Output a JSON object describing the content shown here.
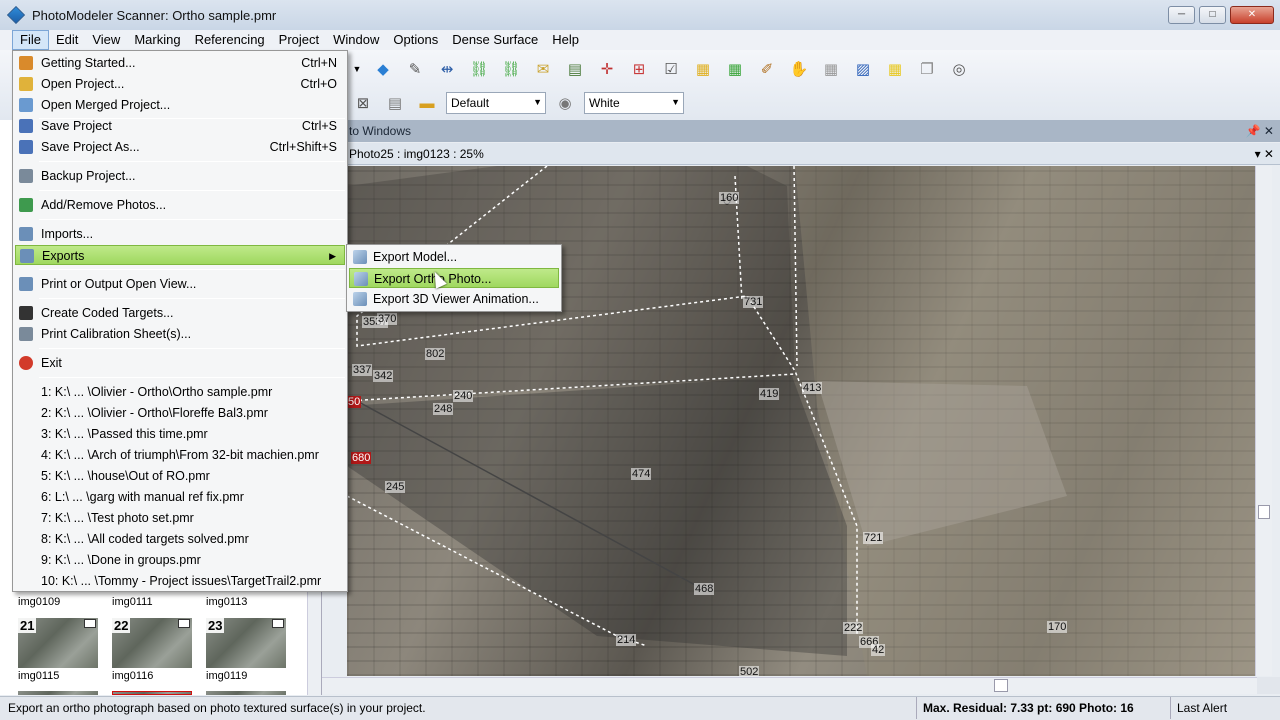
{
  "window": {
    "title": "PhotoModeler Scanner: Ortho sample.pmr",
    "min": "─",
    "max": "□",
    "close": "✕"
  },
  "menubar": [
    "File",
    "Edit",
    "View",
    "Marking",
    "Referencing",
    "Project",
    "Window",
    "Options",
    "Dense Surface",
    "Help"
  ],
  "toolbar": {
    "layer_select": "Default",
    "color_select": "White"
  },
  "dock": {
    "title": "to Windows",
    "controls": "📌 ✕"
  },
  "photo_window": {
    "title": "Photo25 : img0123 : 25%",
    "controls": "▾ ✕"
  },
  "file_menu": {
    "items": [
      {
        "label": "Getting Started...",
        "shortcut": "Ctrl+N",
        "icon": "getting-started-icon",
        "color": "#d98a2b"
      },
      {
        "label": "Open Project...",
        "shortcut": "Ctrl+O",
        "icon": "open-folder-icon",
        "color": "#e0b23a"
      },
      {
        "label": "Open Merged Project...",
        "shortcut": "",
        "icon": "merge-icon",
        "color": "#6a9ad0"
      },
      {
        "label": "Save Project",
        "shortcut": "Ctrl+S",
        "icon": "save-icon",
        "color": "#4a72b8"
      },
      {
        "label": "Save Project As...",
        "shortcut": "Ctrl+Shift+S",
        "icon": "save-as-icon",
        "color": "#4a72b8"
      },
      {
        "label": "Backup Project...",
        "shortcut": "",
        "icon": "backup-icon",
        "color": "#7a8a9a"
      },
      {
        "label": "Add/Remove Photos...",
        "shortcut": "",
        "icon": "photos-icon",
        "color": "#3e9a4e"
      },
      {
        "label": "Imports...",
        "shortcut": "",
        "icon": "import-icon",
        "color": "#6b8fb8"
      },
      {
        "label": "Exports",
        "shortcut": "",
        "icon": "export-icon",
        "color": "#6b8fb8"
      },
      {
        "label": "Print or Output Open View...",
        "shortcut": "",
        "icon": "print-icon",
        "color": "#6b8fb8"
      },
      {
        "label": "Create Coded Targets...",
        "shortcut": "",
        "icon": "coded-target-icon",
        "color": "#333333"
      },
      {
        "label": "Print Calibration Sheet(s)...",
        "shortcut": "",
        "icon": "print-calibration-icon",
        "color": "#7a8a9a"
      },
      {
        "label": "Exit",
        "shortcut": "",
        "icon": "exit-icon",
        "color": "#d23a2a"
      }
    ],
    "recent": [
      "1: K:\\ ... \\Olivier - Ortho\\Ortho sample.pmr",
      "2: K:\\ ... \\Olivier - Ortho\\Floreffe Bal3.pmr",
      "3: K:\\ ... \\Passed this time.pmr",
      "4: K:\\ ... \\Arch of triumph\\From 32-bit machien.pmr",
      "5: K:\\ ... \\house\\Out of RO.pmr",
      "6: L:\\ ... \\garg with manual ref fix.pmr",
      "7: K:\\ ... \\Test photo set.pmr",
      "8: K:\\ ... \\All coded targets solved.pmr",
      "9: K:\\ ... \\Done in groups.pmr",
      "10: K:\\ ... \\Tommy - Project issues\\TargetTrail2.pmr"
    ]
  },
  "exports_submenu": [
    "Export Model...",
    "Export Ortho Photo...",
    "Export 3D Viewer Animation..."
  ],
  "thumbnails": {
    "captions_top": [
      "img0109",
      "img0111",
      "img0113"
    ],
    "items": [
      {
        "num": "21",
        "caption": "img0115"
      },
      {
        "num": "22",
        "caption": "img0116"
      },
      {
        "num": "23",
        "caption": "img0119"
      }
    ]
  },
  "photo_labels": [
    "160",
    "731",
    "3537",
    "370",
    "802",
    "337",
    "342",
    "240",
    "248",
    "419",
    "413",
    "474",
    "245",
    "468",
    "721",
    "214",
    "222",
    "666",
    "42",
    "170",
    "502"
  ],
  "photo_labels_red": [
    "50",
    "680"
  ],
  "status": {
    "message": "Export an ortho photograph based on photo textured surface(s) in your project.",
    "residual": "Max. Residual: 7.33 pt: 690 Photo: 16",
    "alert": "Last Alert"
  }
}
